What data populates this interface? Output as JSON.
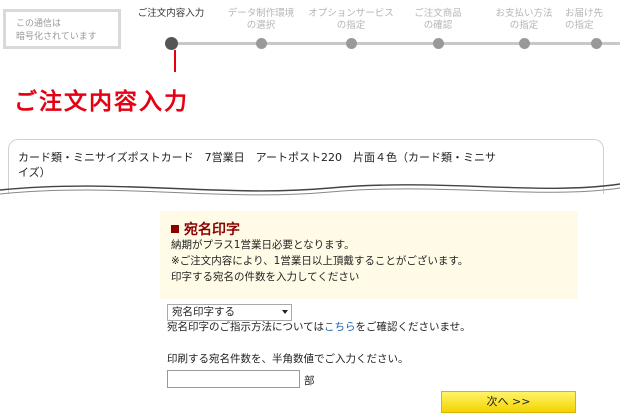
{
  "security": {
    "line1": "この通信は",
    "line2": "暗号化されています"
  },
  "steps": [
    {
      "line1": "ご注文内容入力",
      "line2": "",
      "active": true
    },
    {
      "line1": "データ制作環境",
      "line2": "の選択",
      "active": false
    },
    {
      "line1": "オプションサービス",
      "line2": "の指定",
      "active": false
    },
    {
      "line1": "ご注文商品",
      "line2": "の確認",
      "active": false
    },
    {
      "line1": "お支払い方法",
      "line2": "の指定",
      "active": false
    },
    {
      "line1": "お届け先",
      "line2": "の指定",
      "active": false
    }
  ],
  "page_title": "ご注文内容入力",
  "product": {
    "line1": "カード類・ミニサイズポストカード　7営業日　アートポスト220　片面４色（カード類・ミニサ",
    "line2": "イズ）"
  },
  "notice": {
    "title": "宛名印字",
    "line1": "納期がプラス1営業日必要となります。",
    "line2": "※ご注文内容により、1営業日以上頂戴することがございます。",
    "line3": "印字する宛名の件数を入力してください"
  },
  "address_select": {
    "selected": "宛名印字する"
  },
  "instruction": {
    "before": "宛名印字のご指示方法については",
    "link": "こちら",
    "after": "をご確認くださいませ。"
  },
  "count_prompt": "印刷する宛名件数を、半角数値でご入力ください。",
  "count_input": {
    "value": ""
  },
  "count_unit": "部",
  "next_button": "次へ >>"
}
